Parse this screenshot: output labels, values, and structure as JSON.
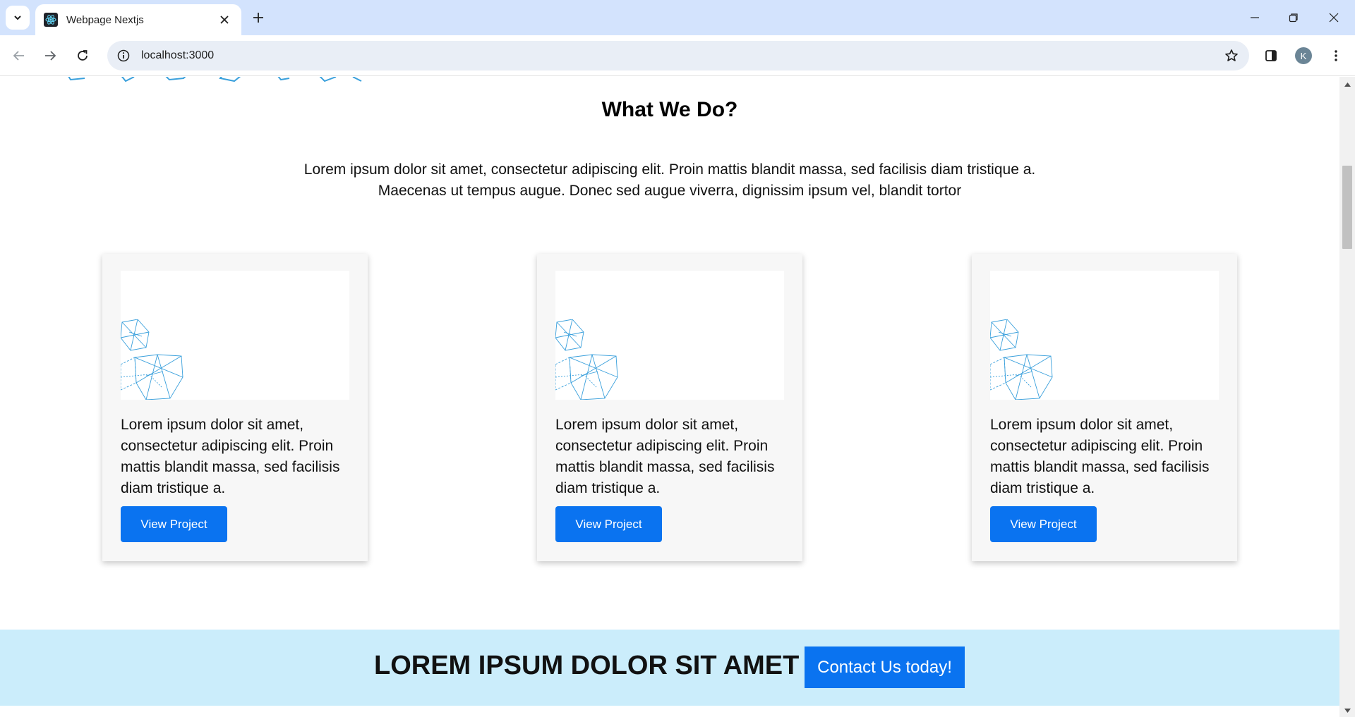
{
  "browser": {
    "tab_title": "Webpage Nextjs",
    "url": "localhost:3000",
    "profile_initial": "K"
  },
  "page": {
    "section_title": "What We Do?",
    "section_desc_line1": "Lorem ipsum dolor sit amet, consectetur adipiscing elit. Proin mattis blandit massa, sed facilisis diam tristique a.",
    "section_desc_line2": "Maecenas ut tempus augue. Donec sed augue viverra, dignissim ipsum vel, blandit tortor",
    "cards": [
      {
        "text": "Lorem ipsum dolor sit amet, consectetur adipiscing elit. Proin mattis blandit massa, sed facilisis diam tristique a.",
        "button": "View Project"
      },
      {
        "text": "Lorem ipsum dolor sit amet, consectetur adipiscing elit. Proin mattis blandit massa, sed facilisis diam tristique a.",
        "button": "View Project"
      },
      {
        "text": "Lorem ipsum dolor sit amet, consectetur adipiscing elit. Proin mattis blandit massa, sed facilisis diam tristique a.",
        "button": "View Project"
      }
    ],
    "cta": {
      "title": "LOREM IPSUM DOLOR SIT AMET",
      "button": "Contact Us today!"
    }
  },
  "colors": {
    "accent": "#0a73f0",
    "cta_band": "#cbedfb",
    "tab_strip": "#d3e3fd",
    "network_line": "#3aa0dc"
  },
  "icons": [
    "tab-search-icon",
    "react-favicon-icon",
    "close-icon",
    "plus-icon",
    "minimize-icon",
    "restore-icon",
    "window-close-icon",
    "back-icon",
    "forward-icon",
    "reload-icon",
    "site-info-icon",
    "star-icon",
    "side-panel-icon",
    "menu-icon"
  ]
}
